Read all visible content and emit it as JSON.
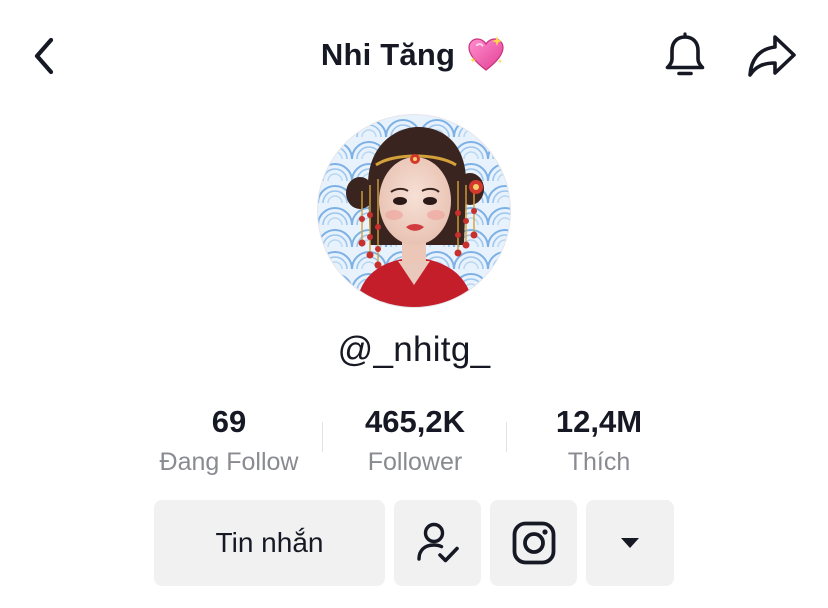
{
  "header": {
    "title": "Nhi Tăng",
    "title_emoji": "sparkling-heart-icon",
    "back_icon": "chevron-left-icon",
    "notification_icon": "bell-icon",
    "share_icon": "share-arrow-icon"
  },
  "profile": {
    "username": "@_nhitg_"
  },
  "stats": [
    {
      "value": "69",
      "label": "Đang Follow"
    },
    {
      "value": "465,2K",
      "label": "Follower"
    },
    {
      "value": "12,4M",
      "label": "Thích"
    }
  ],
  "actions": {
    "message_label": "Tin nhắn",
    "friends_icon": "user-check-icon",
    "instagram_icon": "instagram-icon",
    "more_icon": "caret-down-icon"
  },
  "colors": {
    "text": "#161823",
    "secondary_text": "#8a8b91",
    "button_bg": "#f1f1f2",
    "heart_pink": "#f25aa9"
  }
}
